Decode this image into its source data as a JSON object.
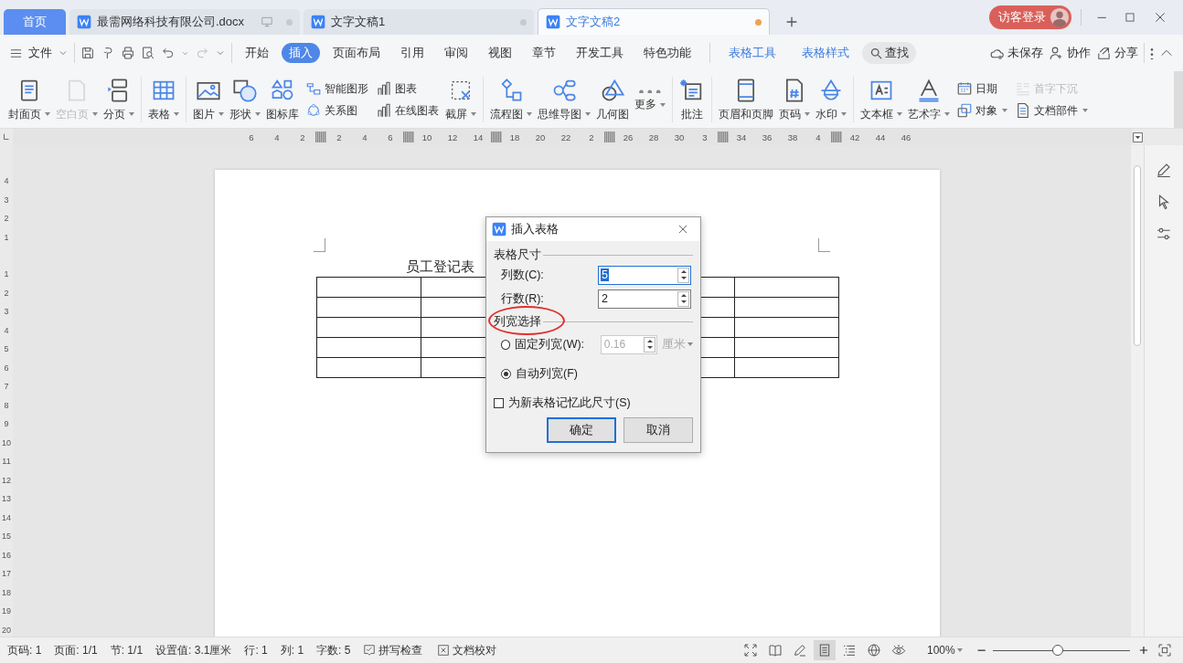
{
  "tabs": [
    {
      "label": "首页",
      "kind": "home",
      "selected": false
    },
    {
      "label": "最需网络科技有限公司.docx",
      "kind": "doc",
      "selected": false,
      "modified": false,
      "device_icon": true
    },
    {
      "label": "文字文稿1",
      "kind": "doc",
      "selected": false,
      "modified": false,
      "device_icon": false
    },
    {
      "label": "文字文稿2",
      "kind": "doc",
      "selected": true,
      "modified": true,
      "device_icon": false
    }
  ],
  "account": {
    "label": "访客登录"
  },
  "menu": {
    "file": "文件",
    "tabs": [
      {
        "label": "开始",
        "kind": "main",
        "selected": false
      },
      {
        "label": "插入",
        "kind": "main",
        "selected": true
      },
      {
        "label": "页面布局",
        "kind": "main",
        "selected": false
      },
      {
        "label": "引用",
        "kind": "main",
        "selected": false
      },
      {
        "label": "审阅",
        "kind": "main",
        "selected": false
      },
      {
        "label": "视图",
        "kind": "main",
        "selected": false
      },
      {
        "label": "章节",
        "kind": "main",
        "selected": false
      },
      {
        "label": "开发工具",
        "kind": "main",
        "selected": false
      },
      {
        "label": "特色功能",
        "kind": "main",
        "selected": false
      },
      {
        "label": "表格工具",
        "kind": "context",
        "selected": false
      },
      {
        "label": "表格样式",
        "kind": "context",
        "selected": false
      }
    ],
    "search": "查找",
    "actions": [
      "未保存",
      "协作",
      "分享"
    ]
  },
  "ribbon": [
    {
      "items": [
        {
          "kind": "big",
          "label": "封面页",
          "dropdown": true,
          "disabled": false
        },
        {
          "kind": "big",
          "label": "空白页",
          "dropdown": true,
          "disabled": true
        },
        {
          "kind": "big",
          "label": "分页",
          "dropdown": true,
          "disabled": false
        }
      ]
    },
    {
      "items": [
        {
          "kind": "big",
          "label": "表格",
          "dropdown": true,
          "disabled": false
        }
      ]
    },
    {
      "items": [
        {
          "kind": "big",
          "label": "图片",
          "dropdown": true,
          "disabled": false
        },
        {
          "kind": "big",
          "label": "形状",
          "dropdown": true,
          "disabled": false
        },
        {
          "kind": "big",
          "label": "图标库",
          "dropdown": false,
          "disabled": false
        },
        {
          "kind": "stack",
          "items": [
            {
              "label": "智能图形",
              "dropdown": false,
              "disabled": false
            },
            {
              "label": "关系图",
              "dropdown": false,
              "disabled": false
            }
          ]
        },
        {
          "kind": "stack",
          "items": [
            {
              "label": "图表",
              "dropdown": false,
              "disabled": false
            },
            {
              "label": "在线图表",
              "dropdown": false,
              "disabled": false
            }
          ]
        },
        {
          "kind": "big",
          "label": "截屏",
          "dropdown": true,
          "disabled": false
        }
      ]
    },
    {
      "items": [
        {
          "kind": "big",
          "label": "流程图",
          "dropdown": true,
          "disabled": false
        },
        {
          "kind": "big",
          "label": "思维导图",
          "dropdown": true,
          "disabled": false
        },
        {
          "kind": "big",
          "label": "几何图",
          "dropdown": false,
          "disabled": false
        },
        {
          "kind": "big",
          "label": "更多",
          "dropdown": true,
          "disabled": false
        }
      ]
    },
    {
      "items": [
        {
          "kind": "big",
          "label": "批注",
          "dropdown": false,
          "disabled": false
        }
      ]
    },
    {
      "items": [
        {
          "kind": "big",
          "label": "页眉和页脚",
          "dropdown": false,
          "disabled": false
        },
        {
          "kind": "big",
          "label": "页码",
          "dropdown": true,
          "disabled": false
        },
        {
          "kind": "big",
          "label": "水印",
          "dropdown": true,
          "disabled": false
        }
      ]
    },
    {
      "items": [
        {
          "kind": "big",
          "label": "文本框",
          "dropdown": true,
          "disabled": false
        },
        {
          "kind": "big",
          "label": "艺术字",
          "dropdown": true,
          "disabled": false
        },
        {
          "kind": "stack",
          "items": [
            {
              "label": "日期",
              "dropdown": false,
              "disabled": false
            },
            {
              "label": "对象",
              "dropdown": true,
              "disabled": false
            }
          ]
        },
        {
          "kind": "stack",
          "items": [
            {
              "label": "首字下沉",
              "dropdown": false,
              "disabled": true
            },
            {
              "label": "文档部件",
              "dropdown": true,
              "disabled": false
            }
          ]
        }
      ]
    }
  ],
  "ruler": {
    "top": [
      {
        "kind": "label",
        "label": "6"
      },
      {
        "kind": "label",
        "label": "4"
      },
      {
        "kind": "label",
        "label": "2"
      },
      {
        "kind": "marker"
      },
      {
        "kind": "label",
        "label": "2"
      },
      {
        "kind": "label",
        "label": "4"
      },
      {
        "kind": "label",
        "label": "6"
      },
      {
        "kind": "marker"
      },
      {
        "kind": "label",
        "label": "10"
      },
      {
        "kind": "label",
        "label": "12"
      },
      {
        "kind": "label",
        "label": "14"
      },
      {
        "kind": "marker"
      },
      {
        "kind": "label",
        "label": "18"
      },
      {
        "kind": "label",
        "label": "20"
      },
      {
        "kind": "label",
        "label": "22"
      },
      {
        "kind": "label",
        "label": "2"
      },
      {
        "kind": "marker"
      },
      {
        "kind": "label",
        "label": "26"
      },
      {
        "kind": "label",
        "label": "28"
      },
      {
        "kind": "label",
        "label": "30"
      },
      {
        "kind": "label",
        "label": "3"
      },
      {
        "kind": "marker"
      },
      {
        "kind": "label",
        "label": "34"
      },
      {
        "kind": "label",
        "label": "36"
      },
      {
        "kind": "label",
        "label": "38"
      },
      {
        "kind": "label",
        "label": "4"
      },
      {
        "kind": "marker"
      },
      {
        "kind": "label",
        "label": "42"
      },
      {
        "kind": "label",
        "label": "44"
      },
      {
        "kind": "label",
        "label": "46"
      }
    ],
    "side_above": [
      "4",
      "3",
      "2",
      "1"
    ],
    "side_below": [
      "1",
      "2",
      "3",
      "4",
      "5",
      "6",
      "7",
      "8",
      "9",
      "10",
      "11",
      "12",
      "13",
      "14",
      "15",
      "16",
      "17",
      "18",
      "19",
      "20"
    ]
  },
  "document": {
    "title": "员工登记表"
  },
  "dialog": {
    "title": "插入表格",
    "size_section": "表格尺寸",
    "fields": [
      {
        "label": "列数(C):",
        "value": "5",
        "focused": true
      },
      {
        "label": "行数(R):",
        "value": "2",
        "focused": false
      }
    ],
    "width_section": "列宽选择",
    "width_section_circled": true,
    "options": [
      {
        "label": "固定列宽(W):",
        "selected": false,
        "value": "0.16",
        "unit": "厘米"
      },
      {
        "label": "自动列宽(F)",
        "selected": true
      }
    ],
    "remember": {
      "label": "为新表格记忆此尺寸(S)",
      "checked": false
    },
    "buttons": [
      {
        "label": "确定",
        "default": true
      },
      {
        "label": "取消",
        "default": false
      }
    ]
  },
  "status_bar": {
    "items": [
      "页码: 1",
      "页面: 1/1",
      "节: 1/1",
      "设置值: 3.1厘米",
      "行: 1",
      "列: 1",
      "字数: 5"
    ],
    "tools": [
      "拼写检查",
      "文档校对"
    ],
    "view_modes": [
      {
        "selected": false
      },
      {
        "selected": false
      },
      {
        "selected": false
      },
      {
        "selected": true
      },
      {
        "selected": false
      },
      {
        "selected": false
      },
      {
        "selected": false
      }
    ],
    "zoom": "100%",
    "zoom_slider": {
      "level": 0.47
    }
  }
}
